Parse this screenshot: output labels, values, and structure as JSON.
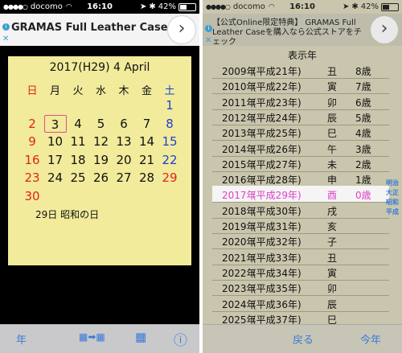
{
  "left": {
    "status": {
      "signal": "●●●●○",
      "carrier": "docomo",
      "time": "16:10",
      "battery": "42%"
    },
    "ad": {
      "title": "GRAMAS Full Leather Case",
      "info": "i",
      "close": "✕",
      "next": "›"
    },
    "calendar": {
      "header": "2017(H29) 4 April",
      "dow": [
        "日",
        "月",
        "火",
        "水",
        "木",
        "金",
        "土"
      ],
      "rows": [
        [
          "",
          "",
          "",
          "",
          "",
          "",
          "1"
        ],
        [
          "2",
          "3",
          "4",
          "5",
          "6",
          "7",
          "8"
        ],
        [
          "9",
          "10",
          "11",
          "12",
          "13",
          "14",
          "15"
        ],
        [
          "16",
          "17",
          "18",
          "19",
          "20",
          "21",
          "22"
        ],
        [
          "23",
          "24",
          "25",
          "26",
          "27",
          "28",
          "29"
        ],
        [
          "30",
          "",
          "",
          "",
          "",
          "",
          ""
        ]
      ],
      "today": "3",
      "holiday": "29日 昭和の日"
    },
    "toolbar": {
      "year": "年",
      "convert": "▦➡▦",
      "grid": "▦",
      "info": "ⓘ"
    },
    "colors": {
      "sunday": "#e0241f",
      "saturday": "#1f3fd0",
      "weekday": "#111111"
    }
  },
  "right": {
    "status": {
      "signal": "●●●●○",
      "carrier": "docomo",
      "time": "16:10",
      "battery": "42%"
    },
    "ad": {
      "line1": "【公式Online限定特典】 GRAMAS Full",
      "line2": "Leather Caseを購入なら公式ストアをチ",
      "line3": "ェック",
      "info": "i",
      "close": "✕",
      "next": "›"
    },
    "list_title": "表示年",
    "years": [
      {
        "y": "2009年",
        "era": "(平成21年)",
        "zodiac": "丑",
        "age": "8歳"
      },
      {
        "y": "2010年",
        "era": "(平成22年)",
        "zodiac": "寅",
        "age": "7歳"
      },
      {
        "y": "2011年",
        "era": "(平成23年)",
        "zodiac": "卯",
        "age": "6歳"
      },
      {
        "y": "2012年",
        "era": "(平成24年)",
        "zodiac": "辰",
        "age": "5歳"
      },
      {
        "y": "2013年",
        "era": "(平成25年)",
        "zodiac": "巳",
        "age": "4歳"
      },
      {
        "y": "2014年",
        "era": "(平成26年)",
        "zodiac": "午",
        "age": "3歳"
      },
      {
        "y": "2015年",
        "era": "(平成27年)",
        "zodiac": "未",
        "age": "2歳"
      },
      {
        "y": "2016年",
        "era": "(平成28年)",
        "zodiac": "申",
        "age": "1歳"
      },
      {
        "y": "2017年",
        "era": "(平成29年)",
        "zodiac": "酉",
        "age": "0歳"
      },
      {
        "y": "2018年",
        "era": "(平成30年)",
        "zodiac": "戌",
        "age": ""
      },
      {
        "y": "2019年",
        "era": "(平成31年)",
        "zodiac": "亥",
        "age": ""
      },
      {
        "y": "2020年",
        "era": "(平成32年)",
        "zodiac": "子",
        "age": ""
      },
      {
        "y": "2021年",
        "era": "(平成33年)",
        "zodiac": "丑",
        "age": ""
      },
      {
        "y": "2022年",
        "era": "(平成34年)",
        "zodiac": "寅",
        "age": ""
      },
      {
        "y": "2023年",
        "era": "(平成35年)",
        "zodiac": "卯",
        "age": ""
      },
      {
        "y": "2024年",
        "era": "(平成36年)",
        "zodiac": "辰",
        "age": ""
      },
      {
        "y": "2025年",
        "era": "(平成37年)",
        "zodiac": "巳",
        "age": ""
      }
    ],
    "selected_index": 8,
    "era_index": [
      "明治",
      "大正",
      "昭和",
      "平成"
    ],
    "toolbar": {
      "back": "戻る",
      "this_year": "今年"
    }
  }
}
